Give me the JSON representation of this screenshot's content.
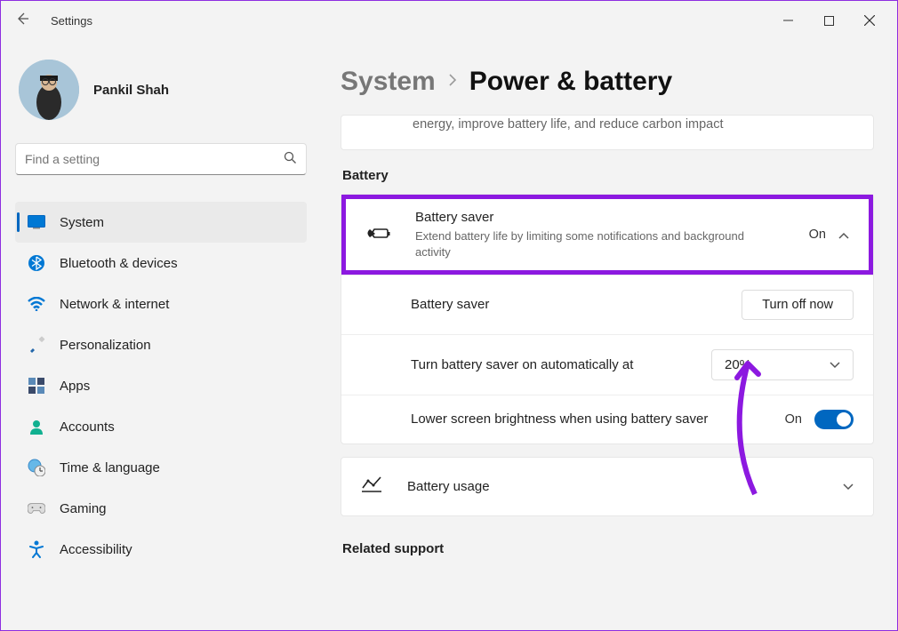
{
  "titlebar": {
    "app_title": "Settings"
  },
  "user": {
    "name": "Pankil Shah"
  },
  "search": {
    "placeholder": "Find a setting"
  },
  "sidebar": {
    "items": [
      {
        "label": "System"
      },
      {
        "label": "Bluetooth & devices"
      },
      {
        "label": "Network & internet"
      },
      {
        "label": "Personalization"
      },
      {
        "label": "Apps"
      },
      {
        "label": "Accounts"
      },
      {
        "label": "Time & language"
      },
      {
        "label": "Gaming"
      },
      {
        "label": "Accessibility"
      }
    ]
  },
  "breadcrumb": {
    "parent": "System",
    "current": "Power & battery"
  },
  "fragment_card_text": "energy, improve battery life, and reduce carbon impact",
  "sections": {
    "battery_label": "Battery",
    "related_support_label": "Related support"
  },
  "battery_saver": {
    "title": "Battery saver",
    "description": "Extend battery life by limiting some notifications and background activity",
    "state": "On",
    "rows": {
      "saver_label": "Battery saver",
      "turn_off_button": "Turn off now",
      "auto_label": "Turn battery saver on automatically at",
      "auto_value": "20%",
      "brightness_label": "Lower screen brightness when using battery saver",
      "brightness_state": "On"
    }
  },
  "battery_usage": {
    "title": "Battery usage"
  }
}
